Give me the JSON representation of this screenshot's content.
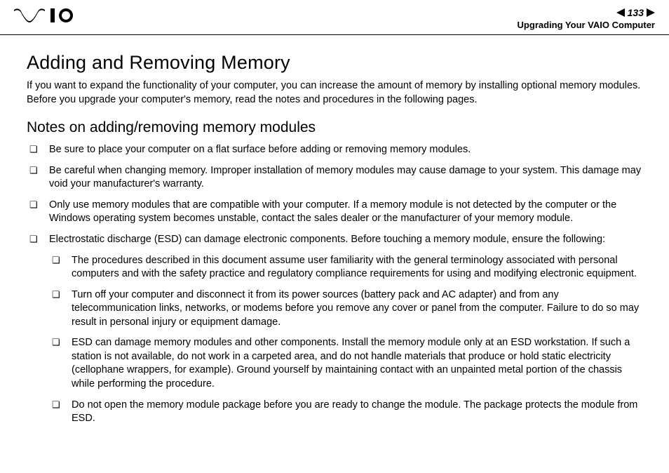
{
  "header": {
    "page_number": "133",
    "section": "Upgrading Your VAIO Computer"
  },
  "content": {
    "title": "Adding and Removing Memory",
    "intro": "If you want to expand the functionality of your computer, you can increase the amount of memory by installing optional memory modules. Before you upgrade your computer's memory, read the notes and procedures in the following pages.",
    "subtitle": "Notes on adding/removing memory modules",
    "bullets": [
      "Be sure to place your computer on a flat surface before adding or removing memory modules.",
      "Be careful when changing memory. Improper installation of memory modules may cause damage to your system. This damage may void your manufacturer's warranty.",
      "Only use memory modules that are compatible with your computer. If a memory module is not detected by the computer or the Windows operating system becomes unstable, contact the sales dealer or the manufacturer of your memory module.",
      "Electrostatic discharge (ESD) can damage electronic components. Before touching a memory module, ensure the following:"
    ],
    "nested": [
      "The procedures described in this document assume user familiarity with the general terminology associated with personal computers and with the safety practice and regulatory compliance requirements for using and modifying electronic equipment.",
      "Turn off your computer and disconnect it from its power sources (battery pack and AC adapter) and from any telecommunication links, networks, or modems before you remove any cover or panel from the computer. Failure to do so may result in personal injury or equipment damage.",
      "ESD can damage memory modules and other components. Install the memory module only at an ESD workstation. If such a station is not available, do not work in a carpeted area, and do not handle materials that produce or hold static electricity (cellophane wrappers, for example). Ground yourself by maintaining contact with an unpainted metal portion of the chassis while performing the procedure.",
      "Do not open the memory module package before you are ready to change the module. The package protects the module from ESD."
    ]
  }
}
